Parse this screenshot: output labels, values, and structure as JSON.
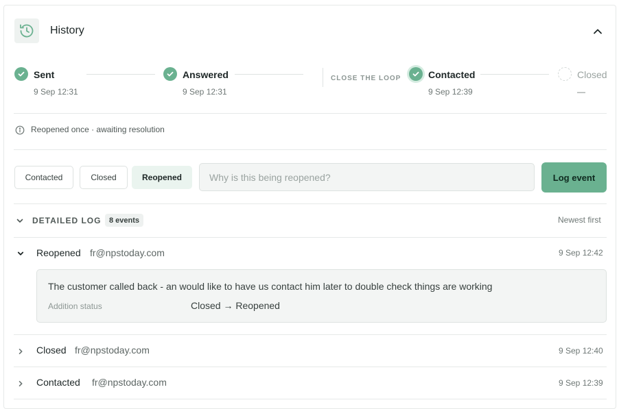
{
  "header": {
    "title": "History",
    "icon": "history-icon"
  },
  "steps": [
    {
      "label": "Sent",
      "date": "9 Sep 12:31",
      "status": "done"
    },
    {
      "label": "Answered",
      "date": "9 Sep 12:31",
      "status": "done"
    },
    {
      "label": "Contacted",
      "date": "9 Sep 12:39",
      "status": "current"
    },
    {
      "label": "Closed",
      "date": "—",
      "status": "pending"
    }
  ],
  "close_the_loop_label": "CLOSE THE LOOP",
  "info": {
    "text": "Reopened once · awaiting resolution"
  },
  "actions": {
    "chips": [
      "Contacted",
      "Closed",
      "Reopened"
    ],
    "active_chip": "Reopened",
    "input_placeholder": "Why is this being reopened?",
    "input_value": "",
    "log_button_label": "Log event"
  },
  "log": {
    "title": "DETAILED LOG",
    "count_label": "8 events",
    "sort_label": "Newest first",
    "events": [
      {
        "name": "Reopened",
        "user": "fr@npstoday.com",
        "time": "9 Sep 12:42",
        "expanded": true,
        "note": "The customer called back - an would like to have us contact him later to double check things are working",
        "field_label": "Addition status",
        "field_value": "Closed → Reopened"
      },
      {
        "name": "Closed",
        "user": "fr@npstoday.com",
        "time": "9 Sep 12:40",
        "expanded": false
      },
      {
        "name": "Contacted",
        "user": "fr@npstoday.com",
        "time": "9 Sep 12:39",
        "expanded": false
      }
    ]
  },
  "colors": {
    "accent": "#6ab190",
    "accent_light": "#eaf4ef",
    "border": "#e6e9e8"
  }
}
